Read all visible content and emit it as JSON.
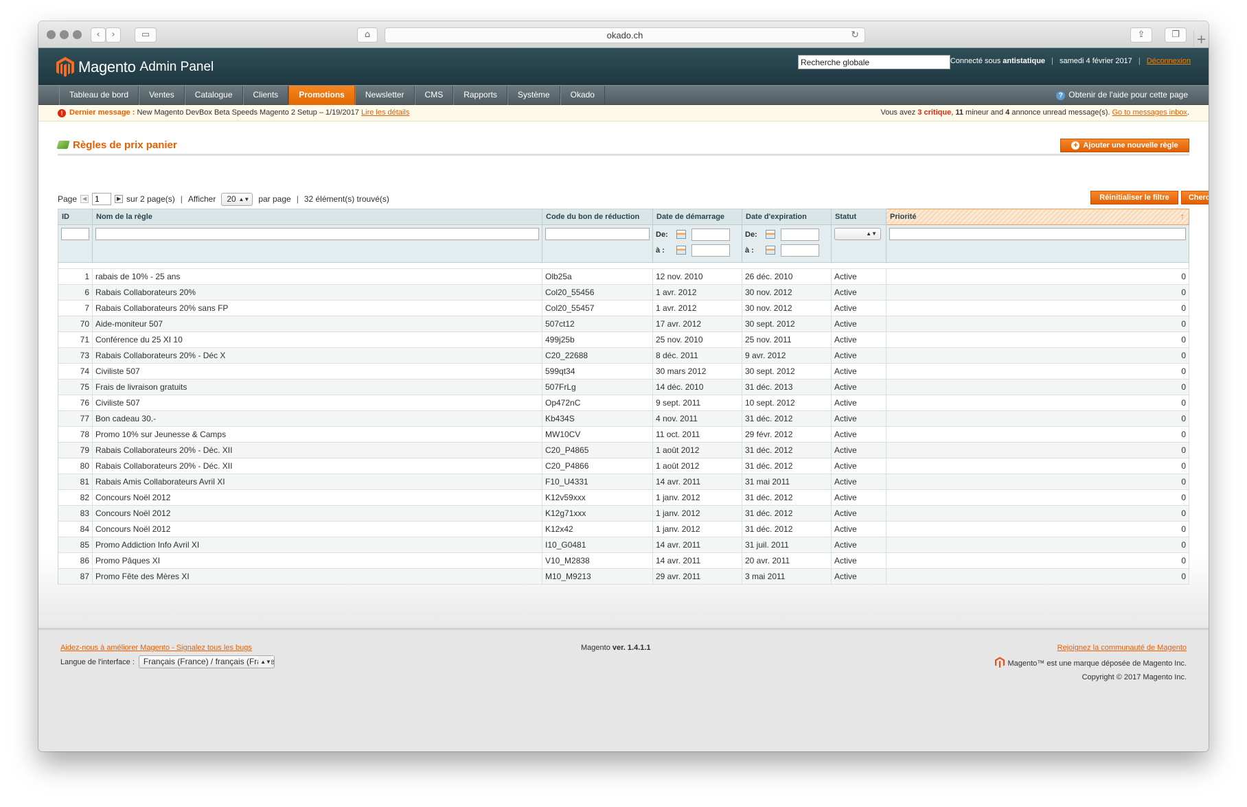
{
  "browser": {
    "url": "okado.ch"
  },
  "header": {
    "logo_text": "Magento",
    "logo_sub": "Admin Panel",
    "search_value": "Recherche globale",
    "connected_label": "Connecté sous",
    "user": "antistatique",
    "date": "samedi 4 février 2017",
    "logout": "Déconnexion"
  },
  "nav": {
    "items": [
      "Tableau de bord",
      "Ventes",
      "Catalogue",
      "Clients",
      "Promotions",
      "Newsletter",
      "CMS",
      "Rapports",
      "Système",
      "Okado"
    ],
    "active": "Promotions",
    "help": "Obtenir de l'aide pour cette page"
  },
  "message": {
    "label": "Dernier message :",
    "text": "New Magento DevBox Beta Speeds Magento 2 Setup – 1/19/2017",
    "link": "Lire les détails",
    "right_prefix": "Vous avez",
    "critical_count": "3 critique",
    "minor_count": "11",
    "minor_text": "mineur and",
    "notice_count": "4",
    "notice_text": "annonce unread message(s).",
    "inbox_link": "Go to messages inbox"
  },
  "page": {
    "title": "Règles de prix panier",
    "add_button": "Ajouter une nouvelle règle",
    "reset_button": "Réinitialiser le filtre",
    "search_button": "Chercher"
  },
  "pager": {
    "page_label": "Page",
    "page_value": "1",
    "of_pages": "sur 2 page(s)",
    "show_label": "Afficher",
    "per_page_value": "20",
    "per_page_label": "par page",
    "found": "32 élément(s) trouvé(s)"
  },
  "grid": {
    "columns": [
      "ID",
      "Nom de la règle",
      "Code du bon de réduction",
      "Date de démarrage",
      "Date d'expiration",
      "Statut",
      "Priorité"
    ],
    "date_from": "De:",
    "date_to": "à :",
    "rows": [
      [
        "1",
        "rabais de 10% - 25 ans",
        "Olb25a",
        "12 nov. 2010",
        "26 déc. 2010",
        "Active",
        "0"
      ],
      [
        "6",
        "Rabais Collaborateurs 20%",
        "Col20_55456",
        "1 avr. 2012",
        "30 nov. 2012",
        "Active",
        "0"
      ],
      [
        "7",
        "Rabais Collaborateurs 20% sans FP",
        "Col20_55457",
        "1 avr. 2012",
        "30 nov. 2012",
        "Active",
        "0"
      ],
      [
        "70",
        "Aide-moniteur 507",
        "507ct12",
        "17 avr. 2012",
        "30 sept. 2012",
        "Active",
        "0"
      ],
      [
        "71",
        "Conférence du 25 XI 10",
        "499j25b",
        "25 nov. 2010",
        "25 nov. 2011",
        "Active",
        "0"
      ],
      [
        "73",
        "Rabais Collaborateurs 20% - Déc X",
        "C20_22688",
        "8 déc. 2011",
        "9 avr. 2012",
        "Active",
        "0"
      ],
      [
        "74",
        "Civiliste 507",
        "599qt34",
        "30 mars 2012",
        "30 sept. 2012",
        "Active",
        "0"
      ],
      [
        "75",
        "Frais de livraison gratuits",
        "507FrLg",
        "14 déc. 2010",
        "31 déc. 2013",
        "Active",
        "0"
      ],
      [
        "76",
        "Civiliste 507",
        "Op472nC",
        "9 sept. 2011",
        "10 sept. 2012",
        "Active",
        "0"
      ],
      [
        "77",
        "Bon cadeau 30.-",
        "Kb434S",
        "4 nov. 2011",
        "31 déc. 2012",
        "Active",
        "0"
      ],
      [
        "78",
        "Promo 10% sur Jeunesse & Camps",
        "MW10CV",
        "11 oct. 2011",
        "29 févr. 2012",
        "Active",
        "0"
      ],
      [
        "79",
        "Rabais Collaborateurs 20% - Déc. XII",
        "C20_P4865",
        "1 août 2012",
        "31 déc. 2012",
        "Active",
        "0"
      ],
      [
        "80",
        "Rabais Collaborateurs 20% - Déc. XII",
        "C20_P4866",
        "1 août 2012",
        "31 déc. 2012",
        "Active",
        "0"
      ],
      [
        "81",
        "Rabais Amis Collaborateurs Avril XI",
        "F10_U4331",
        "14 avr. 2011",
        "31 mai 2011",
        "Active",
        "0"
      ],
      [
        "82",
        "Concours Noël 2012",
        "K12v59xxx",
        "1 janv. 2012",
        "31 déc. 2012",
        "Active",
        "0"
      ],
      [
        "83",
        "Concours Noël 2012",
        "K12g71xxx",
        "1 janv. 2012",
        "31 déc. 2012",
        "Active",
        "0"
      ],
      [
        "84",
        "Concours Noël 2012",
        "K12x42",
        "1 janv. 2012",
        "31 déc. 2012",
        "Active",
        "0"
      ],
      [
        "85",
        "Promo Addiction Info Avril XI",
        "I10_G0481",
        "14 avr. 2011",
        "31 juil. 2011",
        "Active",
        "0"
      ],
      [
        "86",
        "Promo Pâques XI",
        "V10_M2838",
        "14 avr. 2011",
        "20 avr. 2011",
        "Active",
        "0"
      ],
      [
        "87",
        "Promo Fête des Mères XI",
        "M10_M9213",
        "29 avr. 2011",
        "3 mai 2011",
        "Active",
        "0"
      ]
    ]
  },
  "footer": {
    "help_link": "Aidez-nous à améliorer Magento - Signalez tous les bugs",
    "lang_label": "Langue de l'interface :",
    "lang_value": "Français (France) / français (France)",
    "version_prefix": "Magento",
    "version": "ver. 1.4.1.1",
    "community_link": "Rejoignez la communauté de Magento",
    "trademark": "Magento™ est une marque déposée de Magento Inc.",
    "copyright": "Copyright © 2017 Magento Inc."
  },
  "colors": {
    "accent": "#eb5e00",
    "header_bg": "#2f4f59",
    "nav_active": "#f5861f"
  }
}
